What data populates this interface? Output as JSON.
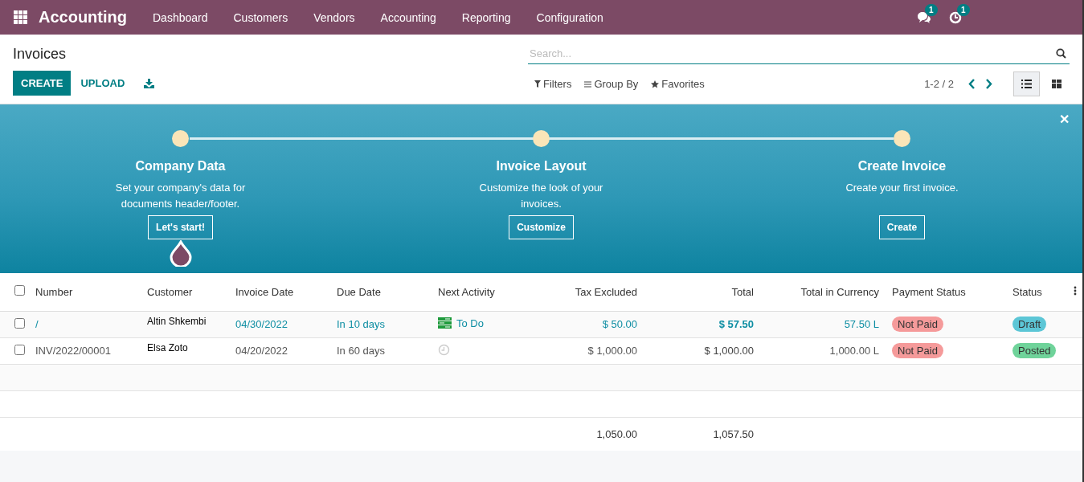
{
  "navbar": {
    "app_name": "Accounting",
    "menu": [
      "Dashboard",
      "Customers",
      "Vendors",
      "Accounting",
      "Reporting",
      "Configuration"
    ],
    "messages_count": "1",
    "activities_count": "1"
  },
  "control_panel": {
    "title": "Invoices",
    "buttons": [
      "CREATE",
      "UPLOAD"
    ],
    "search": {
      "placeholder": "Search..."
    },
    "filters": [
      "Filters",
      "Group By",
      "Favorites"
    ],
    "pager": "1-2 / 2",
    "views": [
      {
        "kind": "list",
        "selected": true
      },
      {
        "kind": "kanban",
        "selected": false
      }
    ]
  },
  "onboarding": {
    "close": "✕",
    "steps": [
      {
        "title": "Company Data",
        "description": "Set your company's data for documents header/footer.",
        "button": "Let's start!",
        "selected": true
      },
      {
        "title": "Invoice Layout",
        "description": "Customize the look of your invoices.",
        "button": "Customize",
        "selected": false
      },
      {
        "title": "Create Invoice",
        "description": "Create your first invoice.",
        "button": "Create",
        "selected": false
      }
    ]
  },
  "table": {
    "select_all_checked": false,
    "columns": [
      "Number",
      "Customer",
      "Invoice Date",
      "Due Date",
      "Next Activity",
      "Tax Excluded",
      "Total",
      "Total in Currency",
      "Payment Status",
      "Status"
    ],
    "rows": [
      {
        "checked": false,
        "draft": true,
        "number": "/",
        "customer": "Altin Shkembi",
        "invoice_date": "04/30/2022",
        "due_date": "In 10 days",
        "activity": {
          "kind": "todo",
          "label": "To Do"
        },
        "tax_excluded": "$ 50.00",
        "total": "$ 57.50",
        "total_currency": "57.50 L",
        "payment_status": {
          "label": "Not Paid",
          "color": "#f59a9a"
        },
        "status": {
          "label": "Draft",
          "color": "#5cc6d6"
        }
      },
      {
        "checked": false,
        "draft": false,
        "number": "INV/2022/00001",
        "customer": "Elsa Zoto",
        "invoice_date": "04/20/2022",
        "due_date": "In 60 days",
        "activity": {
          "kind": "none"
        },
        "tax_excluded": "$ 1,000.00",
        "total": "$ 1,000.00",
        "total_currency": "1,000.00 L",
        "payment_status": {
          "label": "Not Paid",
          "color": "#f59a9a"
        },
        "status": {
          "label": "Posted",
          "color": "#6fd39a"
        }
      }
    ],
    "totals": {
      "tax_excluded": "1,050.00",
      "total": "1,057.50"
    }
  }
}
